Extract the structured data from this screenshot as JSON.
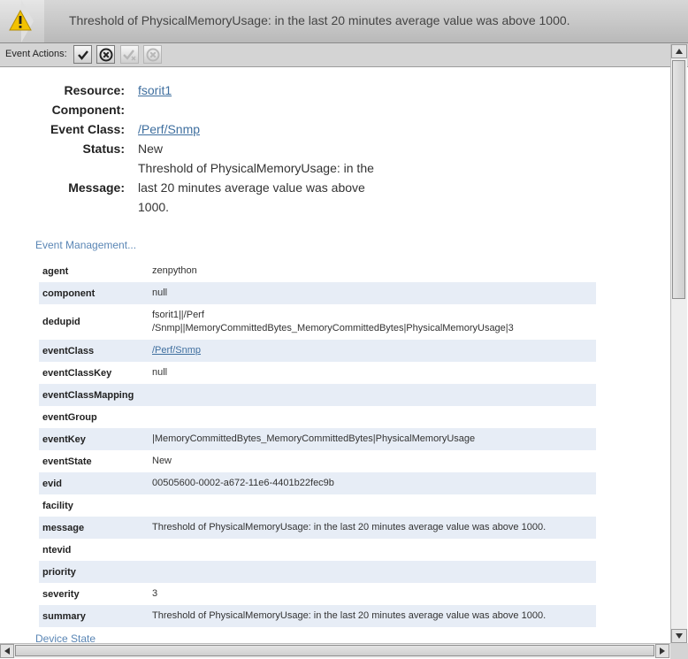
{
  "header": {
    "title": "Threshold of PhysicalMemoryUsage: in the last 20 minutes average value was above 1000.",
    "icon": "warning-icon",
    "colors": {
      "warning": "#f2c200",
      "header_bg": "#c9c9c9"
    }
  },
  "actions": {
    "label": "Event Actions:",
    "buttons": [
      {
        "name": "acknowledge",
        "icon": "check-icon",
        "enabled": true
      },
      {
        "name": "close",
        "icon": "x-circle-icon",
        "enabled": true
      },
      {
        "name": "unacknowledge",
        "icon": "check-x-icon",
        "enabled": false
      },
      {
        "name": "reopen",
        "icon": "x-circle-icon",
        "enabled": false
      }
    ]
  },
  "summary": {
    "resource_label": "Resource:",
    "resource_value": "fsorit1",
    "component_label": "Component:",
    "component_value": "",
    "event_class_label": "Event Class:",
    "event_class_value": "/Perf/Snmp",
    "status_label": "Status:",
    "status_value": "New",
    "message_label": "Message:",
    "message_line1": "Threshold of PhysicalMemoryUsage: in the",
    "message_line2": "last 20 minutes average value was above",
    "message_line3": "1000."
  },
  "event_management_label": "Event Management...",
  "details": [
    {
      "key": "agent",
      "value": "zenpython"
    },
    {
      "key": "component",
      "value": "null"
    },
    {
      "key": "dedupid",
      "value_line1": "fsorit1||/Perf",
      "value_line2": "/Snmp||MemoryCommittedBytes_MemoryCommittedBytes|PhysicalMemoryUsage|3"
    },
    {
      "key": "eventClass",
      "value": "/Perf/Snmp"
    },
    {
      "key": "eventClassKey",
      "value": "null"
    },
    {
      "key": "eventClassMapping",
      "value": ""
    },
    {
      "key": "eventGroup",
      "value": ""
    },
    {
      "key": "eventKey",
      "value": "|MemoryCommittedBytes_MemoryCommittedBytes|PhysicalMemoryUsage"
    },
    {
      "key": "eventState",
      "value": "New"
    },
    {
      "key": "evid",
      "value": "00505600-0002-a672-11e6-4401b22fec9b"
    },
    {
      "key": "facility",
      "value": ""
    },
    {
      "key": "message",
      "value": "Threshold of PhysicalMemoryUsage: in the last 20 minutes average value was above 1000."
    },
    {
      "key": "ntevid",
      "value": ""
    },
    {
      "key": "priority",
      "value": ""
    },
    {
      "key": "severity",
      "value": "3"
    },
    {
      "key": "summary",
      "value": "Threshold of PhysicalMemoryUsage: in the last 20 minutes average value was above 1000."
    }
  ],
  "device_state_label": "Device State"
}
